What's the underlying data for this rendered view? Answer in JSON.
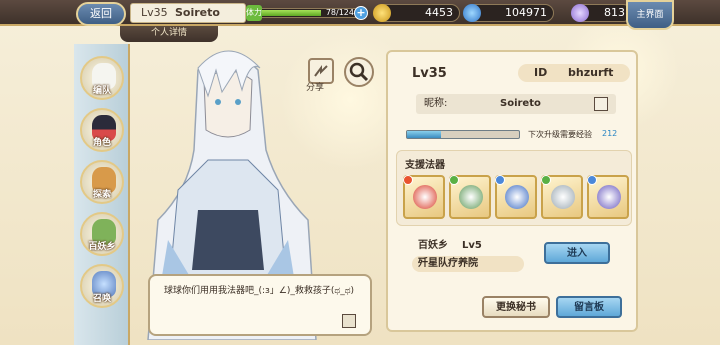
{
  "topbar": {
    "back_label": "返回",
    "player_level": "Lv35",
    "player_name": "Soireto",
    "stamina_tag": "体力",
    "stamina_value": "78/124",
    "stamina_fraction": 0.63,
    "gold": "4453",
    "gems": "104971",
    "crystals": "813",
    "home_label": "主界面"
  },
  "subtab": {
    "label": "个人详情"
  },
  "sidebar": {
    "items": [
      {
        "label": "编队"
      },
      {
        "label": "角色"
      },
      {
        "label": "探索"
      },
      {
        "label": "百妖乡"
      },
      {
        "label": "召唤"
      }
    ]
  },
  "character": {
    "share_label": "分享",
    "speech": "球球你们用用我法器吧_(:з」∠)_救救孩子(ಥ_ಥ)"
  },
  "profile": {
    "level": "Lv35",
    "id_label": "ID",
    "id_value": "bhzurft",
    "nickname_label": "昵称:",
    "nickname_value": "Soireto",
    "xp_fraction": 0.3,
    "xp_label": "下次升级需要经验",
    "xp_value": "212",
    "support_title": "支援法器",
    "relics": [
      {
        "icon": "red-dragon-relic-icon",
        "color": "#d9402e",
        "badge": "#e9532f"
      },
      {
        "icon": "green-vase-relic-icon",
        "color": "#5f9a5a",
        "badge": "#59b044"
      },
      {
        "icon": "blue-scroll-relic-icon",
        "color": "#3f6ec4",
        "badge": "#4c88d9"
      },
      {
        "icon": "silver-ring-relic-icon",
        "color": "#9aa8b2",
        "badge": "#59b044"
      },
      {
        "icon": "purple-sword-relic-icon",
        "color": "#6a5bbf",
        "badge": "#4c88d9"
      }
    ],
    "town_name_label": "百妖乡",
    "town_level": "Lv5",
    "town_title": "歼星队疗养院",
    "enter_label": "进入",
    "secretary_label": "更换秘书",
    "message_board_label": "留言板"
  }
}
